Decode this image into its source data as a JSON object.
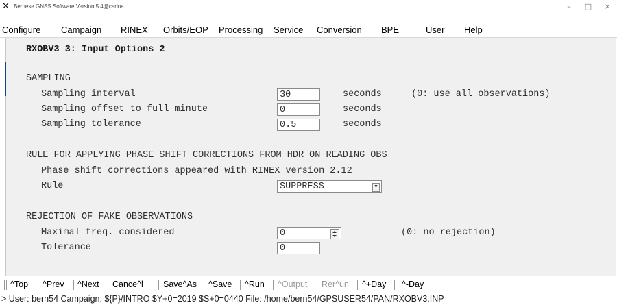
{
  "window": {
    "title": "Bernese GNSS Software Version 5.4@carina",
    "app_icon": "x-logo-icon",
    "controls": [
      "–",
      "□",
      "×"
    ]
  },
  "menu": [
    "Configure",
    "Campaign",
    "RINEX",
    "Orbits/EOP",
    "Processing",
    "Service",
    "Conversion",
    "BPE",
    "User",
    "Help"
  ],
  "panel": {
    "heading": "RXOBV3 3: Input Options 2",
    "sampling": {
      "title": "SAMPLING",
      "interval_label": "Sampling interval",
      "interval_value": "30",
      "interval_unit": "seconds",
      "interval_hint": "(0: use all observations)",
      "offset_label": "Sampling offset to full minute",
      "offset_value": "0",
      "offset_unit": "seconds",
      "tolerance_label": "Sampling tolerance",
      "tolerance_value": "0.5",
      "tolerance_unit": "seconds"
    },
    "phase": {
      "title": "RULE FOR APPLYING PHASE SHIFT CORRECTIONS FROM HDR ON READING OBS",
      "note": "Phase shift corrections appeared with RINEX version 2.12",
      "rule_label": "Rule",
      "rule_value": "SUPPRESS"
    },
    "rejection": {
      "title": "REJECTION OF FAKE OBSERVATIONS",
      "maxfreq_label": "Maximal freq. considered",
      "maxfreq_value": "0",
      "maxfreq_hint": "(0: no rejection)",
      "tolerance_label": "Tolerance",
      "tolerance_value": "0"
    }
  },
  "toolbar": {
    "items": [
      {
        "label": "^Top",
        "enabled": true
      },
      {
        "label": "^Prev",
        "enabled": true
      },
      {
        "label": "^Next",
        "enabled": true
      },
      {
        "label": "Cance^l",
        "enabled": true
      },
      {
        "label": "Save^As",
        "enabled": true
      },
      {
        "label": "^Save",
        "enabled": true
      },
      {
        "label": "^Run",
        "enabled": true
      },
      {
        "label": "^Output",
        "enabled": false
      },
      {
        "label": "Rer^un",
        "enabled": false
      },
      {
        "label": "^+Day",
        "enabled": true
      },
      {
        "label": "^-Day",
        "enabled": true
      }
    ]
  },
  "status": "> User: bern54  Campaign: ${P}/INTRO  $Y+0=2019  $S+0=0440  File: /home/bern54/GPSUSER54/PAN/RXOBV3.INP"
}
